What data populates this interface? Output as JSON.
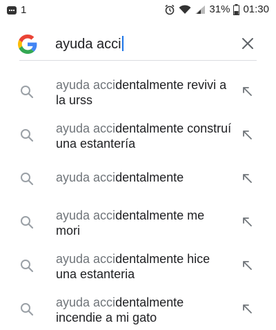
{
  "status_bar": {
    "notification_count": "1",
    "battery": "31%",
    "time": "01:30",
    "icons": [
      "message-icon",
      "alarm-icon",
      "wifi-icon",
      "signal-icon",
      "battery-icon"
    ]
  },
  "search": {
    "query": "ayuda acci",
    "logo": "google-g-logo",
    "clear_icon": "close-icon"
  },
  "suggestions": [
    {
      "typed": "ayuda acci",
      "rest": "dentalmente revivi a la urss"
    },
    {
      "typed": "ayuda acci",
      "rest": "dentalmente construí una estantería"
    },
    {
      "typed": "ayuda acci",
      "rest": "dentalmente"
    },
    {
      "typed": "ayuda acci",
      "rest": "dentalmente me mori"
    },
    {
      "typed": "ayuda acci",
      "rest": "dentalmente hice una estanteria"
    },
    {
      "typed": "ayuda acci",
      "rest": "dentalmente incendie a mi gato"
    }
  ],
  "colors": {
    "typed_text": "#70757a",
    "completion_text": "#202124",
    "icon": "#9aa0a6",
    "google_blue": "#4285F4",
    "google_red": "#EA4335",
    "google_yellow": "#FBBC05",
    "google_green": "#34A853"
  }
}
